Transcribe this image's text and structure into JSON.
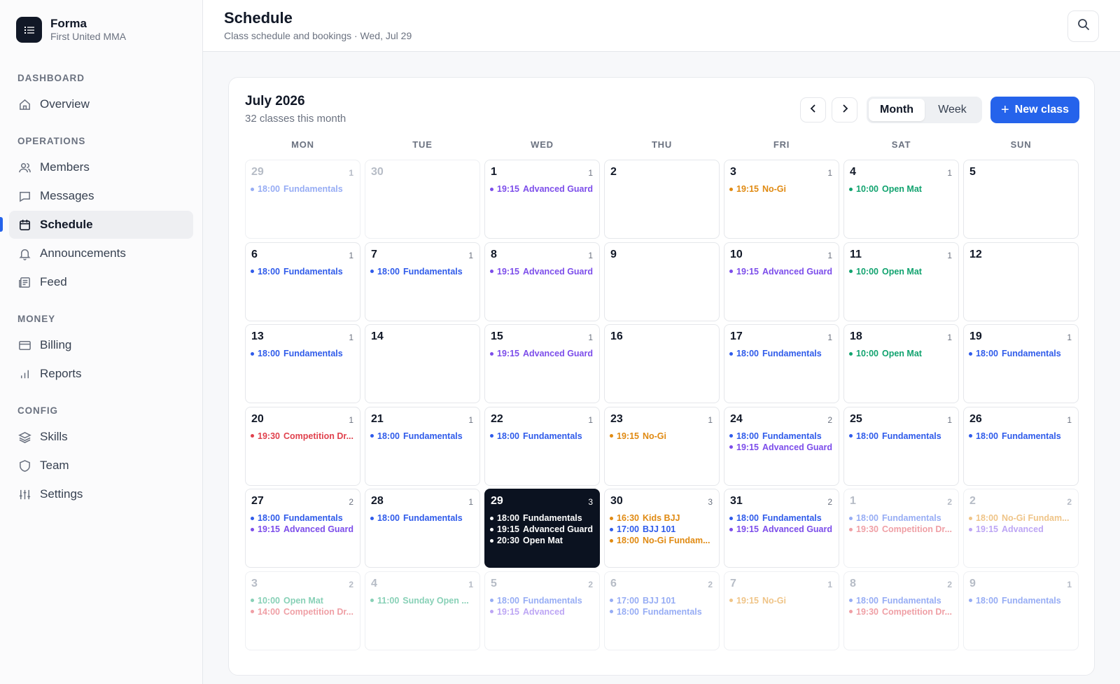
{
  "brand": {
    "name": "Forma",
    "subtitle": "First United MMA",
    "logo_icon": "list-icon"
  },
  "sidebar": {
    "sections": [
      "DASHBOARD",
      "OPERATIONS",
      "MONEY",
      "CONFIG"
    ],
    "items": [
      {
        "label": "Overview",
        "icon": "home-icon"
      },
      {
        "label": "Members",
        "icon": "users-icon"
      },
      {
        "label": "Messages",
        "icon": "message-icon"
      },
      {
        "label": "Schedule",
        "icon": "calendar-icon",
        "active": true
      },
      {
        "label": "Announcements",
        "icon": "bell-icon"
      },
      {
        "label": "Feed",
        "icon": "newspaper-icon"
      },
      {
        "label": "Billing",
        "icon": "credit-card-icon"
      },
      {
        "label": "Reports",
        "icon": "bar-chart-icon"
      },
      {
        "label": "Skills",
        "icon": "layers-icon"
      },
      {
        "label": "Team",
        "icon": "shield-icon"
      },
      {
        "label": "Settings",
        "icon": "sliders-icon"
      }
    ]
  },
  "header": {
    "title": "Schedule",
    "subtitle": "Class schedule and bookings · Wed, Jul 29",
    "search_icon": "search-icon"
  },
  "calendar": {
    "title": "July 2026",
    "subtitle": "32 classes this month",
    "view_month": "Month",
    "view_week": "Week",
    "active_view": "Month",
    "new_class": "New class",
    "weekdays": [
      "MON",
      "TUE",
      "WED",
      "THU",
      "FRI",
      "SAT",
      "SUN"
    ],
    "colors": {
      "Fundamentals": "#2f5bea",
      "Advanced": "#7c4dea",
      "NoGi": "#e08a12",
      "OpenMat": "#12a36f",
      "Competition": "#e0414d",
      "Kids": "#e08a12",
      "BJJ101": "#2f5bea"
    },
    "days": [
      {
        "day": "29",
        "count": "1",
        "out": true,
        "events": [
          {
            "time": "18:00",
            "name": "Fundamentals",
            "type": "Fundamentals"
          }
        ]
      },
      {
        "day": "30",
        "count": "",
        "out": true,
        "events": []
      },
      {
        "day": "1",
        "count": "1",
        "events": [
          {
            "time": "19:15",
            "name": "Advanced Guard",
            "type": "Advanced"
          }
        ]
      },
      {
        "day": "2",
        "count": "",
        "events": []
      },
      {
        "day": "3",
        "count": "1",
        "events": [
          {
            "time": "19:15",
            "name": "No-Gi",
            "type": "NoGi"
          }
        ]
      },
      {
        "day": "4",
        "count": "1",
        "events": [
          {
            "time": "10:00",
            "name": "Open Mat",
            "type": "OpenMat"
          }
        ]
      },
      {
        "day": "5",
        "count": "",
        "events": []
      },
      {
        "day": "6",
        "count": "1",
        "events": [
          {
            "time": "18:00",
            "name": "Fundamentals",
            "type": "Fundamentals"
          }
        ]
      },
      {
        "day": "7",
        "count": "1",
        "events": [
          {
            "time": "18:00",
            "name": "Fundamentals",
            "type": "Fundamentals"
          }
        ]
      },
      {
        "day": "8",
        "count": "1",
        "events": [
          {
            "time": "19:15",
            "name": "Advanced Guard",
            "type": "Advanced"
          }
        ]
      },
      {
        "day": "9",
        "count": "",
        "events": []
      },
      {
        "day": "10",
        "count": "1",
        "events": [
          {
            "time": "19:15",
            "name": "Advanced Guard",
            "type": "Advanced"
          }
        ]
      },
      {
        "day": "11",
        "count": "1",
        "events": [
          {
            "time": "10:00",
            "name": "Open Mat",
            "type": "OpenMat"
          }
        ]
      },
      {
        "day": "12",
        "count": "",
        "events": []
      },
      {
        "day": "13",
        "count": "1",
        "events": [
          {
            "time": "18:00",
            "name": "Fundamentals",
            "type": "Fundamentals"
          }
        ]
      },
      {
        "day": "14",
        "count": "",
        "events": []
      },
      {
        "day": "15",
        "count": "1",
        "events": [
          {
            "time": "19:15",
            "name": "Advanced Guard",
            "type": "Advanced"
          }
        ]
      },
      {
        "day": "16",
        "count": "",
        "events": []
      },
      {
        "day": "17",
        "count": "1",
        "events": [
          {
            "time": "18:00",
            "name": "Fundamentals",
            "type": "Fundamentals"
          }
        ]
      },
      {
        "day": "18",
        "count": "1",
        "events": [
          {
            "time": "10:00",
            "name": "Open Mat",
            "type": "OpenMat"
          }
        ]
      },
      {
        "day": "19",
        "count": "1",
        "events": [
          {
            "time": "18:00",
            "name": "Fundamentals",
            "type": "Fundamentals"
          }
        ]
      },
      {
        "day": "20",
        "count": "1",
        "events": [
          {
            "time": "19:30",
            "name": "Competition Dr...",
            "type": "Competition"
          }
        ]
      },
      {
        "day": "21",
        "count": "1",
        "events": [
          {
            "time": "18:00",
            "name": "Fundamentals",
            "type": "Fundamentals"
          }
        ]
      },
      {
        "day": "22",
        "count": "1",
        "events": [
          {
            "time": "18:00",
            "name": "Fundamentals",
            "type": "Fundamentals"
          }
        ]
      },
      {
        "day": "23",
        "count": "1",
        "events": [
          {
            "time": "19:15",
            "name": "No-Gi",
            "type": "NoGi"
          }
        ]
      },
      {
        "day": "24",
        "count": "2",
        "events": [
          {
            "time": "18:00",
            "name": "Fundamentals",
            "type": "Fundamentals"
          },
          {
            "time": "19:15",
            "name": "Advanced Guard",
            "type": "Advanced"
          }
        ]
      },
      {
        "day": "25",
        "count": "1",
        "events": [
          {
            "time": "18:00",
            "name": "Fundamentals",
            "type": "Fundamentals"
          }
        ]
      },
      {
        "day": "26",
        "count": "1",
        "events": [
          {
            "time": "18:00",
            "name": "Fundamentals",
            "type": "Fundamentals"
          }
        ]
      },
      {
        "day": "27",
        "count": "2",
        "events": [
          {
            "time": "18:00",
            "name": "Fundamentals",
            "type": "Fundamentals"
          },
          {
            "time": "19:15",
            "name": "Advanced Guard",
            "type": "Advanced"
          }
        ]
      },
      {
        "day": "28",
        "count": "1",
        "events": [
          {
            "time": "18:00",
            "name": "Fundamentals",
            "type": "Fundamentals"
          }
        ]
      },
      {
        "day": "29",
        "count": "3",
        "today": true,
        "events": [
          {
            "time": "18:00",
            "name": "Fundamentals",
            "type": "Fundamentals"
          },
          {
            "time": "19:15",
            "name": "Advanced Guard",
            "type": "Advanced"
          },
          {
            "time": "20:30",
            "name": "Open Mat",
            "type": "OpenMat"
          }
        ]
      },
      {
        "day": "30",
        "count": "3",
        "events": [
          {
            "time": "16:30",
            "name": "Kids BJJ",
            "type": "Kids"
          },
          {
            "time": "17:00",
            "name": "BJJ 101",
            "type": "BJJ101"
          },
          {
            "time": "18:00",
            "name": "No-Gi Fundam...",
            "type": "NoGi"
          }
        ]
      },
      {
        "day": "31",
        "count": "2",
        "events": [
          {
            "time": "18:00",
            "name": "Fundamentals",
            "type": "Fundamentals"
          },
          {
            "time": "19:15",
            "name": "Advanced Guard",
            "type": "Advanced"
          }
        ]
      },
      {
        "day": "1",
        "count": "2",
        "out": true,
        "events": [
          {
            "time": "18:00",
            "name": "Fundamentals",
            "type": "Fundamentals"
          },
          {
            "time": "19:30",
            "name": "Competition Dr...",
            "type": "Competition"
          }
        ]
      },
      {
        "day": "2",
        "count": "2",
        "out": true,
        "events": [
          {
            "time": "18:00",
            "name": "No-Gi Fundam...",
            "type": "NoGi"
          },
          {
            "time": "19:15",
            "name": "Advanced",
            "type": "Advanced"
          }
        ]
      },
      {
        "day": "3",
        "count": "2",
        "out": true,
        "events": [
          {
            "time": "10:00",
            "name": "Open Mat",
            "type": "OpenMat"
          },
          {
            "time": "14:00",
            "name": "Competition Dr...",
            "type": "Competition"
          }
        ]
      },
      {
        "day": "4",
        "count": "1",
        "out": true,
        "events": [
          {
            "time": "11:00",
            "name": "Sunday Open ...",
            "type": "OpenMat"
          }
        ]
      },
      {
        "day": "5",
        "count": "2",
        "out": true,
        "events": [
          {
            "time": "18:00",
            "name": "Fundamentals",
            "type": "Fundamentals"
          },
          {
            "time": "19:15",
            "name": "Advanced",
            "type": "Advanced"
          }
        ]
      },
      {
        "day": "6",
        "count": "2",
        "out": true,
        "events": [
          {
            "time": "17:00",
            "name": "BJJ 101",
            "type": "BJJ101"
          },
          {
            "time": "18:00",
            "name": "Fundamentals",
            "type": "Fundamentals"
          }
        ]
      },
      {
        "day": "7",
        "count": "1",
        "out": true,
        "events": [
          {
            "time": "19:15",
            "name": "No-Gi",
            "type": "NoGi"
          }
        ]
      },
      {
        "day": "8",
        "count": "2",
        "out": true,
        "events": [
          {
            "time": "18:00",
            "name": "Fundamentals",
            "type": "Fundamentals"
          },
          {
            "time": "19:30",
            "name": "Competition Dr...",
            "type": "Competition"
          }
        ]
      },
      {
        "day": "9",
        "count": "1",
        "out": true,
        "events": [
          {
            "time": "18:00",
            "name": "Fundamentals",
            "type": "Fundamentals"
          }
        ]
      }
    ]
  }
}
